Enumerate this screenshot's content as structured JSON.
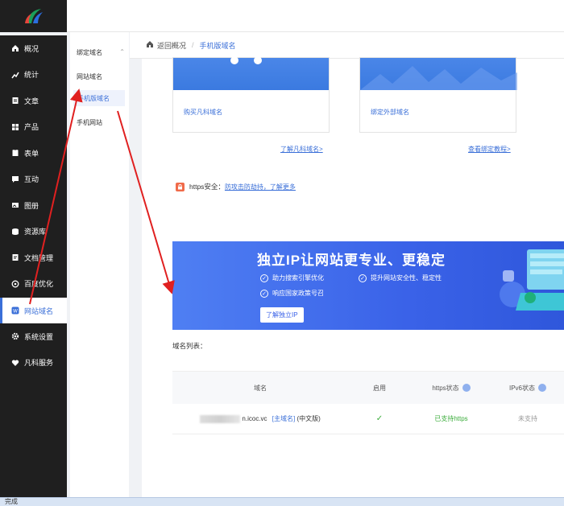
{
  "sidebar": {
    "items": [
      {
        "label": "概况",
        "icon": "home-icon"
      },
      {
        "label": "统计",
        "icon": "stats-icon"
      },
      {
        "label": "文章",
        "icon": "article-icon"
      },
      {
        "label": "产品",
        "icon": "product-icon"
      },
      {
        "label": "表单",
        "icon": "form-icon"
      },
      {
        "label": "互动",
        "icon": "chat-icon"
      },
      {
        "label": "图册",
        "icon": "album-icon"
      },
      {
        "label": "资源库",
        "icon": "database-icon"
      },
      {
        "label": "文档管理",
        "icon": "document-icon"
      },
      {
        "label": "百度优化",
        "icon": "seo-icon"
      },
      {
        "label": "网站域名",
        "icon": "domain-icon"
      },
      {
        "label": "系统设置",
        "icon": "gear-icon"
      },
      {
        "label": "凡科服务",
        "icon": "heart-icon"
      }
    ]
  },
  "submenu": {
    "group_label": "绑定域名",
    "items": [
      "网站域名",
      "手机版域名",
      "手机网站"
    ]
  },
  "breadcrumb": {
    "back": "返回概况",
    "separator": "/",
    "current": "手机版域名"
  },
  "cards": {
    "buy_label": "购买凡科域名",
    "bind_label": "绑定外部域名",
    "learn_link": "了解凡科域名>",
    "tutorial_link": "查看绑定教程>"
  },
  "https_notice": {
    "label": "https安全：",
    "link": "防攻击防劫持，了解更多"
  },
  "banner": {
    "title": "独立IP让网站更专业、更稳定",
    "features": [
      "助力搜索引擎优化",
      "提升网站安全性、稳定性",
      "响应国家政策号召"
    ],
    "button": "了解独立IP"
  },
  "domain_list": {
    "title": "域名列表：",
    "columns": [
      "域名",
      "启用",
      "https状态",
      "IPv6状态"
    ],
    "rows": [
      {
        "domain": "n.icoc.vc",
        "primary_tag": "[主域名]",
        "lang_tag": "(中文版)",
        "enabled": "✓",
        "https": "已支持https",
        "ipv6": "未支持"
      }
    ]
  },
  "statusbar": {
    "text": "完成"
  },
  "colors": {
    "accent": "#3a6fd8",
    "sidebar_bg": "#1f1f1f",
    "success": "#3cad3c",
    "https_badge": "#f06b4a"
  }
}
